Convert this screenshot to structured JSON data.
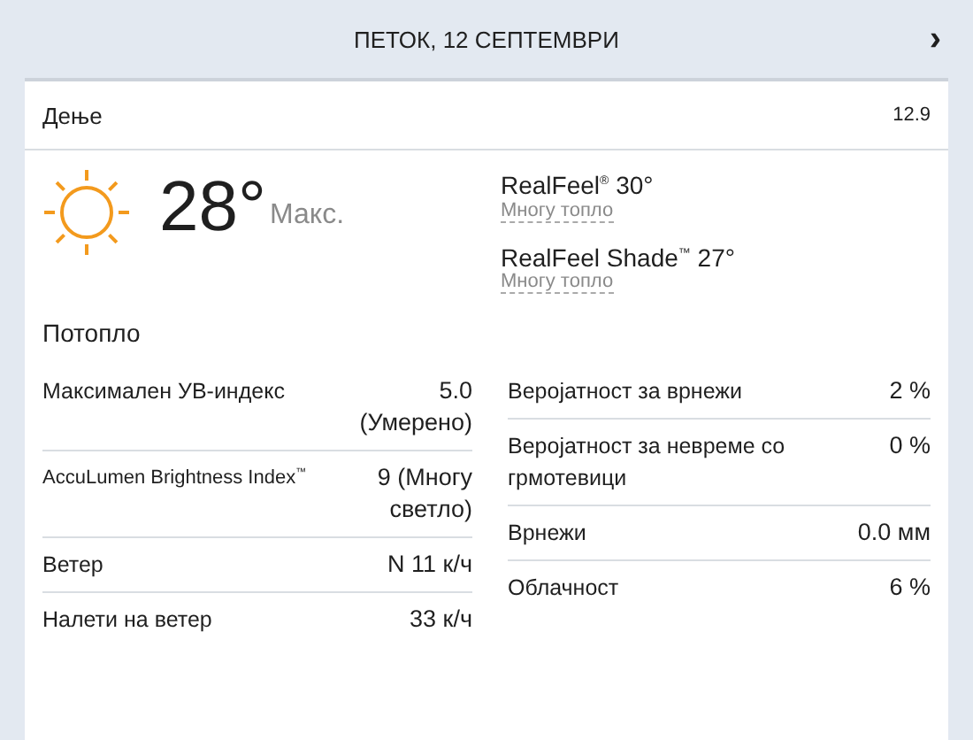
{
  "header": {
    "title": "ПЕТОК, 12 СЕПТЕМВРИ",
    "next": "›"
  },
  "card": {
    "period": "Дење",
    "date": "12.9",
    "temperature": "28°",
    "temperature_label": "Макс.",
    "realfeel": [
      {
        "label": "RealFeel$^{®}$ 30°",
        "phrase": "Многу топло"
      },
      {
        "label": "RealFeel Shade$^{™}$ 27°",
        "phrase": "Многу топло"
      }
    ],
    "phrase": "Потопло",
    "details_left": [
      {
        "label": "Максимален УВ-индекс",
        "value": "5.0 (Умерено)",
        "kind": "normal"
      },
      {
        "label": "AccuLumen Brightness Index$^{™}$",
        "value": "9 (Многу светло)",
        "kind": "small"
      },
      {
        "label": "Ветер",
        "value": "N 11 к/ч",
        "kind": "normal"
      },
      {
        "label": "Налети на ветер",
        "value": "33 к/ч",
        "kind": "normal"
      }
    ],
    "details_right": [
      {
        "label": "Веројатност за врнежи",
        "value": "2 %",
        "kind": "normal"
      },
      {
        "label": "Веројатност за невреме со грмотевици",
        "value": "0 %",
        "kind": "normal"
      },
      {
        "label": "Врнежи",
        "value": "0.0 мм",
        "kind": "normal"
      },
      {
        "label": "Облачност",
        "value": "6 %",
        "kind": "normal"
      }
    ]
  }
}
